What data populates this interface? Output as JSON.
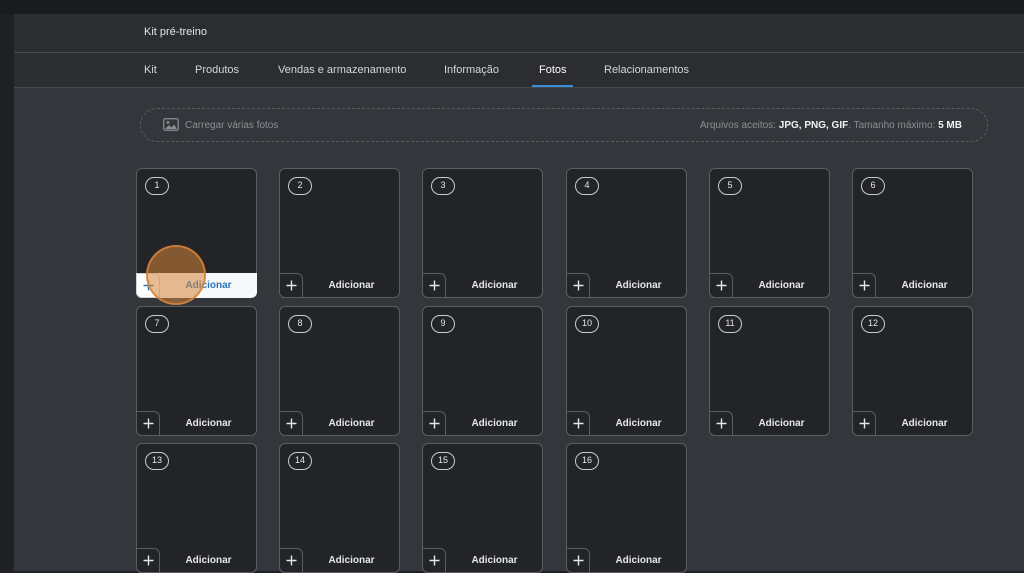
{
  "modal": {
    "title": "Kit pré-treino",
    "tabs": [
      {
        "label": "Kit"
      },
      {
        "label": "Produtos"
      },
      {
        "label": "Vendas e armazenamento"
      },
      {
        "label": "Informação"
      },
      {
        "label": "Fotos",
        "active": true
      },
      {
        "label": "Relacionamentos"
      }
    ]
  },
  "upload": {
    "icon": "image-icon",
    "label": "Carregar várias fotos",
    "accepted_prefix": "Arquivos aceitos:",
    "accepted_formats": "JPG, PNG, GIF",
    "max_size_prefix": ". Tamanho máximo:",
    "max_size": "5 MB"
  },
  "slots": [
    {
      "number": "1",
      "add_label": "Adicionar"
    },
    {
      "number": "2",
      "add_label": "Adicionar"
    },
    {
      "number": "3",
      "add_label": "Adicionar"
    },
    {
      "number": "4",
      "add_label": "Adicionar"
    },
    {
      "number": "5",
      "add_label": "Adicionar"
    },
    {
      "number": "6",
      "add_label": "Adicionar"
    },
    {
      "number": "7",
      "add_label": "Adicionar"
    },
    {
      "number": "8",
      "add_label": "Adicionar"
    },
    {
      "number": "9",
      "add_label": "Adicionar"
    },
    {
      "number": "10",
      "add_label": "Adicionar"
    },
    {
      "number": "11",
      "add_label": "Adicionar"
    },
    {
      "number": "12",
      "add_label": "Adicionar"
    },
    {
      "number": "13",
      "add_label": "Adicionar"
    },
    {
      "number": "14",
      "add_label": "Adicionar"
    },
    {
      "number": "15",
      "add_label": "Adicionar"
    },
    {
      "number": "16",
      "add_label": "Adicionar"
    }
  ],
  "colors": {
    "accent": "#3b8fd6",
    "hover_text": "#2c76b8",
    "click_marker": "#d6843a"
  }
}
